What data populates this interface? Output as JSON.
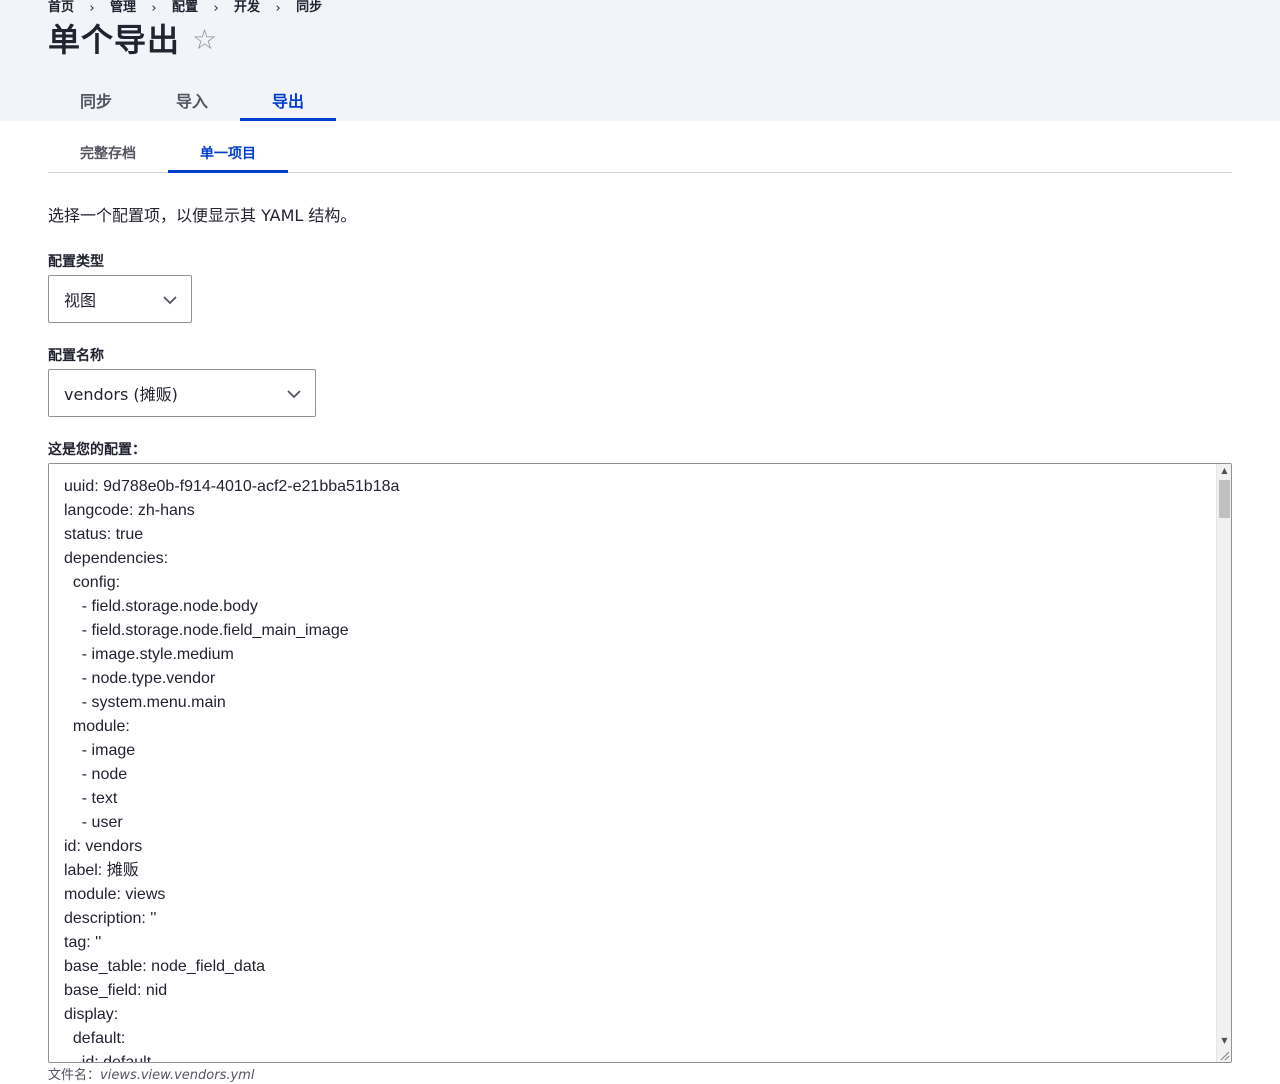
{
  "breadcrumb": [
    "首页",
    "管理",
    "配置",
    "开发",
    "同步"
  ],
  "breadcrumb_separator": "›",
  "page_title": "单个导出",
  "primary_tabs": [
    {
      "label": "同步",
      "active": false
    },
    {
      "label": "导入",
      "active": false
    },
    {
      "label": "导出",
      "active": true
    }
  ],
  "secondary_tabs": [
    {
      "label": "完整存档",
      "active": false
    },
    {
      "label": "单一项目",
      "active": true
    }
  ],
  "description": "选择一个配置项，以便显示其 YAML 结构。",
  "config_type": {
    "label": "配置类型",
    "selected": "视图"
  },
  "config_name": {
    "label": "配置名称",
    "selected": "vendors (摊贩)"
  },
  "config_output": {
    "label": "这是您的配置：",
    "lines": [
      "uuid: 9d788e0b-f914-4010-acf2-e21bba51b18a",
      "langcode: zh-hans",
      "status: true",
      "dependencies:",
      "  config:",
      "    - field.storage.node.body",
      "    - field.storage.node.field_main_image",
      "    - image.style.medium",
      "    - node.type.vendor",
      "    - system.menu.main",
      "  module:",
      "    - image",
      "    - node",
      "    - text",
      "    - user",
      "id: vendors",
      "label: 摊贩",
      "module: views",
      "description: ''",
      "tag: ''",
      "base_table: node_field_data",
      "base_field: nid",
      "display:",
      "  default:",
      "    id: default"
    ]
  },
  "filename": {
    "label": "文件名：",
    "value": "views.view.vendors.yml"
  },
  "colors": {
    "header_bg": "#f3f4f9",
    "accent": "#003ecc",
    "text": "#222330",
    "muted": "#545560"
  }
}
